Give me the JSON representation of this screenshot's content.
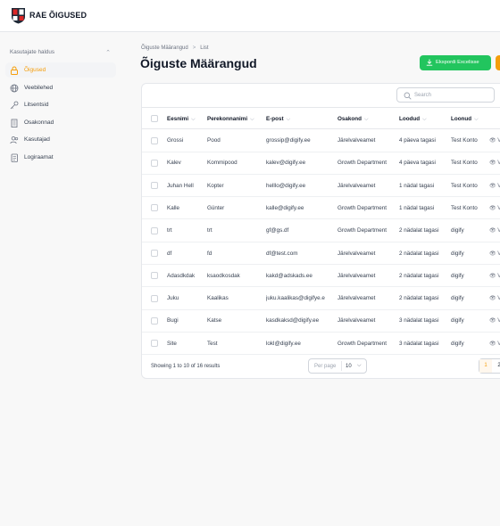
{
  "app": {
    "title": "RAE ÕIGUSED"
  },
  "sidebar": {
    "group_label": "Kasutajate haldus",
    "items": [
      {
        "label": "Õigused",
        "icon": "lock-icon",
        "active": true
      },
      {
        "label": "Veebilehed",
        "icon": "globe-icon",
        "active": false
      },
      {
        "label": "Litsentsid",
        "icon": "key-icon",
        "active": false
      },
      {
        "label": "Osakonnad",
        "icon": "building-icon",
        "active": false
      },
      {
        "label": "Kasutajad",
        "icon": "users-icon",
        "active": false
      },
      {
        "label": "Logiraamat",
        "icon": "log-icon",
        "active": false
      }
    ]
  },
  "breadcrumb": {
    "parent": "Õiguste Määrangud",
    "separator": ">",
    "current": "List"
  },
  "page": {
    "title": "Õiguste Määrangud"
  },
  "toolbar": {
    "export_label": "Ekspordi Excelisse"
  },
  "search": {
    "placeholder": "Search"
  },
  "table": {
    "columns": [
      "Eesnimi",
      "Perekonnanimi",
      "E-post",
      "Osakond",
      "Loodud",
      "Loonud"
    ],
    "view_label": "V",
    "rows": [
      [
        "Grossi",
        "Pood",
        "grossip@digify.ee",
        "Järelvalveamet",
        "4 päeva tagasi",
        "Test Konto"
      ],
      [
        "Kalev",
        "Kommipood",
        "kalev@digify.ee",
        "Growth Department",
        "4 päeva tagasi",
        "Test Konto"
      ],
      [
        "Juhan Hell",
        "Kopter",
        "helllo@digify.ee",
        "Järelvalveamet",
        "1 nädal tagasi",
        "Test Konto"
      ],
      [
        "Kalle",
        "Günter",
        "kalle@digify.ee",
        "Growth Department",
        "1 nädal tagasi",
        "Test Konto"
      ],
      [
        "trt",
        "trt",
        "gf@gs.df",
        "Growth Department",
        "2 nädalat tagasi",
        "digify"
      ],
      [
        "df",
        "fd",
        "df@test.com",
        "Järelvalveamet",
        "2 nädalat tagasi",
        "digify"
      ],
      [
        "Adasdkdak",
        "ksaodkosdak",
        "kakd@adskads.ee",
        "Järelvalveamet",
        "2 nädalat tagasi",
        "digify"
      ],
      [
        "Juku",
        "Kaalikas",
        "juku.kaalikas@digifye.e",
        "Järelvalveamet",
        "2 nädalat tagasi",
        "digify"
      ],
      [
        "Bugi",
        "Katse",
        "kasdkaksd@digify.ee",
        "Järelvalveamet",
        "3 nädalat tagasi",
        "digify"
      ],
      [
        "Site",
        "Test",
        "lokl@digify.ee",
        "Growth Department",
        "3 nädalat tagasi",
        "digify"
      ]
    ]
  },
  "footer": {
    "showing": "Showing 1 to 10 of 16 results",
    "per_page_label": "Per page",
    "per_page_value": "10",
    "pages": [
      "1",
      "2"
    ]
  },
  "colors": {
    "accent": "#f59e0b",
    "export": "#22c55e"
  }
}
